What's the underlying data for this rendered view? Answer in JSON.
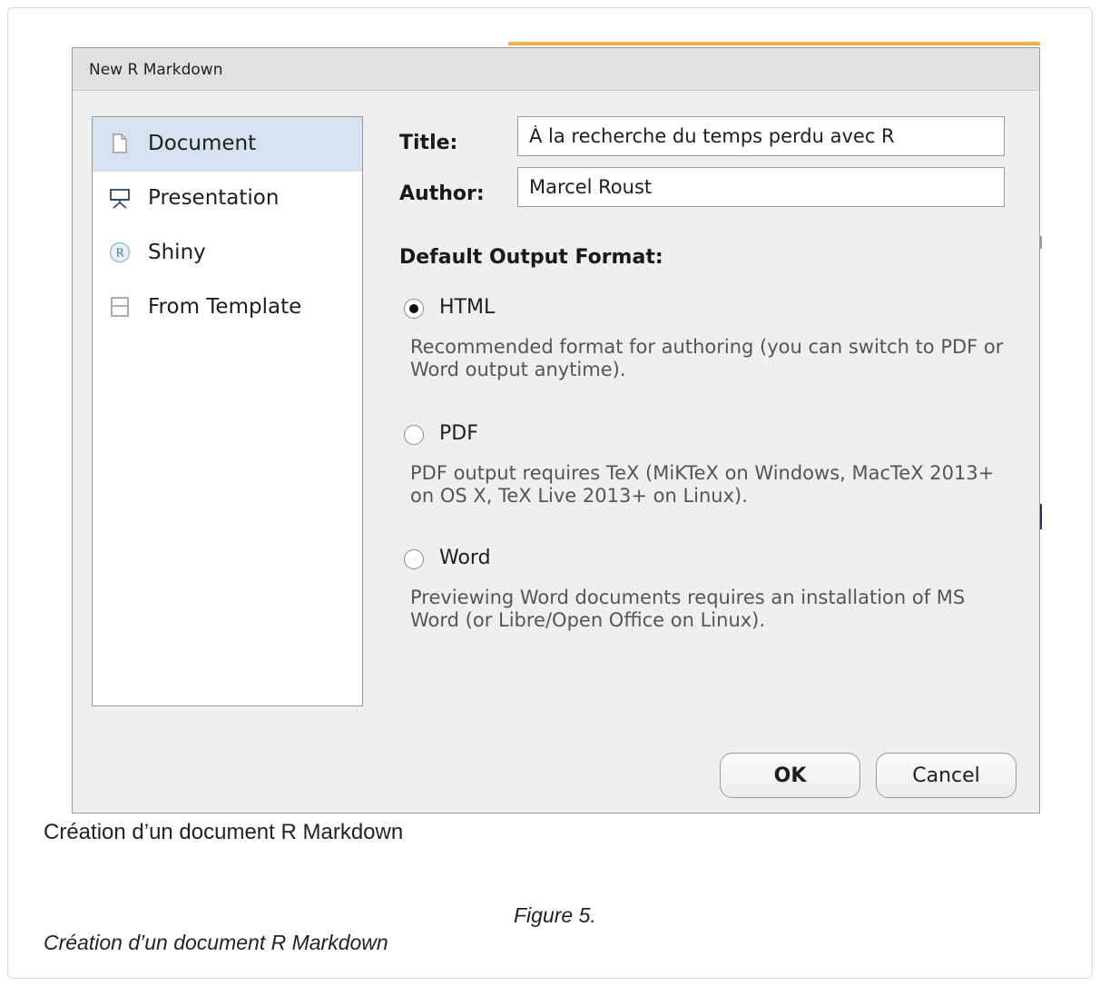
{
  "dialog": {
    "title": "New R Markdown",
    "sidebar": {
      "items": [
        {
          "label": "Document",
          "icon": "document-icon",
          "selected": true
        },
        {
          "label": "Presentation",
          "icon": "presentation-icon",
          "selected": false
        },
        {
          "label": "Shiny",
          "icon": "shiny-r-icon",
          "selected": false
        },
        {
          "label": "From Template",
          "icon": "template-icon",
          "selected": false
        }
      ]
    },
    "form": {
      "title_label": "Title:",
      "title_value": "À la recherche du temps perdu avec R",
      "author_label": "Author:",
      "author_value": "Marcel Roust",
      "output_heading": "Default Output Format:",
      "options": [
        {
          "label": "HTML",
          "checked": true,
          "description": "Recommended format for authoring (you can switch to PDF or Word output anytime)."
        },
        {
          "label": "PDF",
          "checked": false,
          "description": "PDF output requires TeX (MiKTeX on Windows, MacTeX 2013+ on OS X, TeX Live 2013+ on Linux)."
        },
        {
          "label": "Word",
          "checked": false,
          "description": "Previewing Word documents requires an installation of MS Word (or Libre/Open Office on Linux)."
        }
      ]
    },
    "buttons": {
      "ok_label": "OK",
      "cancel_label": "Cancel"
    }
  },
  "caption": "Création d’un document R Markdown",
  "figure_label": "Figure 5.",
  "figure_caption": "Création d’un document R Markdown",
  "colors": {
    "selected_item": "#d5e2ef",
    "dialog_bg": "#efefef",
    "description_text": "#555555"
  }
}
